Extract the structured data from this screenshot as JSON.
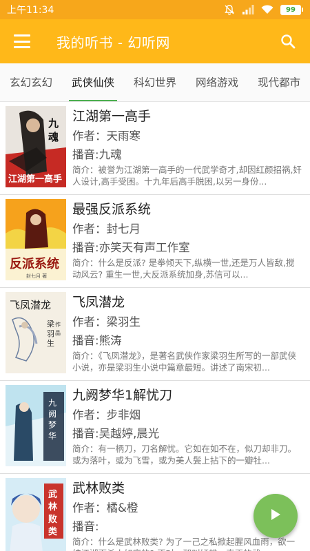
{
  "status_bar": {
    "time": "上午11:34",
    "battery": "99",
    "icons": [
      "mute-icon",
      "signal-icon",
      "wifi-icon",
      "battery-icon"
    ]
  },
  "app_bar": {
    "title": "我的听书 - 幻听网",
    "icons": [
      "menu-icon",
      "search-icon"
    ]
  },
  "tabs": [
    {
      "label": "玄幻玄幻",
      "active": false
    },
    {
      "label": "武侠仙侠",
      "active": true
    },
    {
      "label": "科幻世界",
      "active": false
    },
    {
      "label": "网络游戏",
      "active": false
    },
    {
      "label": "现代都市",
      "active": false
    }
  ],
  "books": [
    {
      "title": "江湖第一高手",
      "author_label": "作者：",
      "author": "天雨寒",
      "narrator_label": "播音:",
      "narrator": "九魂",
      "desc": "简介：被誉为江湖第一高手的一代武学奇才,却因红颜招祸,奸人设计,高手受困。十九年后高手脱困,以另一身份...",
      "cover_text": "九魂 江湖第一高手"
    },
    {
      "title": "最强反派系统",
      "author_label": "作者：",
      "author": "封七月",
      "narrator_label": "播音:",
      "narrator": "亦笑天有声工作室",
      "desc": "简介：什么是反派? 是拳倾天下,纵横一世,还是万人皆敌,搅动风云? 重生一世,大反派系统加身,苏信可以...",
      "cover_text": "反派系统"
    },
    {
      "title": "飞凤潜龙",
      "author_label": "作者：",
      "author": "梁羽生",
      "narrator_label": "播音:",
      "narrator": "熊涛",
      "desc": "简介：《飞凤潜龙》，是著名武侠作家梁羽生所写的一部武侠小说，亦是梁羽生小说中篇章最短。讲述了南宋初...",
      "cover_text": "飞凤潜龙 梁羽生作品"
    },
    {
      "title": "九阙梦华1解忧刀",
      "author_label": "作者：",
      "author": "步非烟",
      "narrator_label": "播音:",
      "narrator": "吴越婷,晨光",
      "desc": "简介：有一柄刀，刀名解忧。它如在如不在，似刀却非刀。或为落叶，或为飞雪，或为美人鬓上拈下的一瓣牡...",
      "cover_text": "九阙梦华"
    },
    {
      "title": "武林败类",
      "author_label": "作者：",
      "author": "橘&橙",
      "narrator_label": "播音:",
      "narrator": "",
      "desc": "简介：什么是武林败类? 为了一己之私掀起腥风血雨，欲一统江湖而杀人如麻的? 不对，那叫奸雄。真正的武...",
      "cover_text": "武林败类"
    }
  ],
  "fab": {
    "icon": "play-icon"
  },
  "colors": {
    "status_bar": "#f7a71b",
    "app_bar": "#ffb819",
    "tab_indicator": "#4caf50",
    "fab": "#7cc05a"
  }
}
